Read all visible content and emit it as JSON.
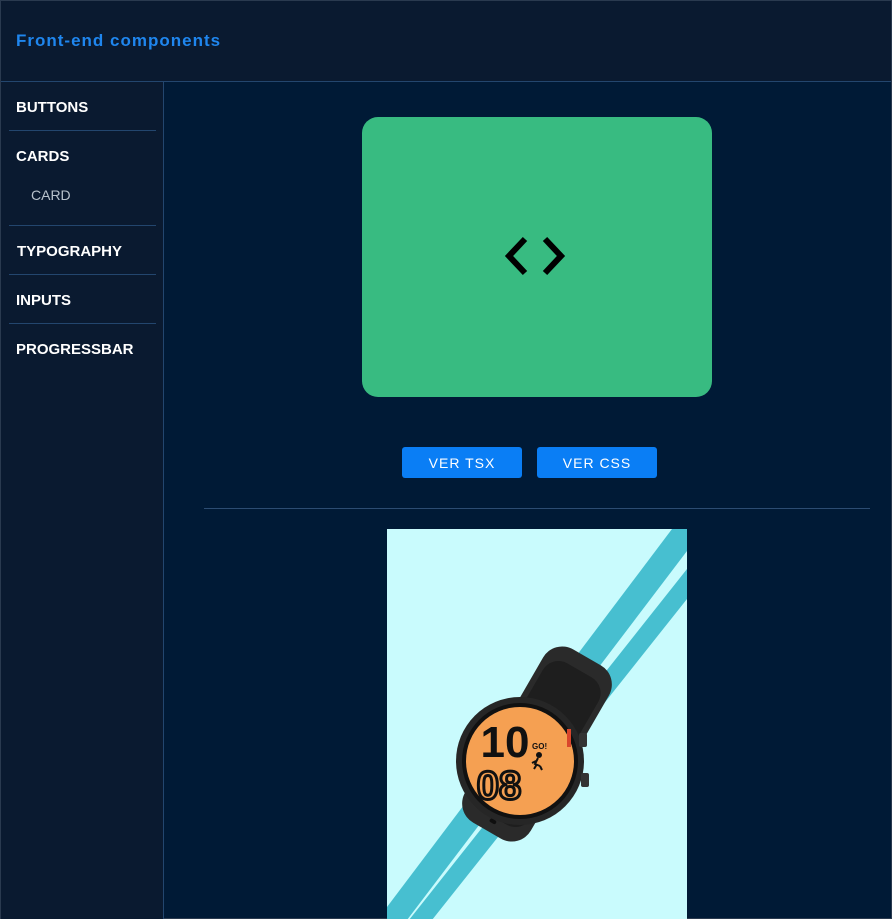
{
  "header": {
    "title": "Front-end components"
  },
  "sidebar": {
    "items": [
      {
        "label": "BUTTONS"
      },
      {
        "label": "CARDS",
        "children": [
          {
            "label": "CARD"
          }
        ]
      },
      {
        "label": "TYPOGRAPHY"
      },
      {
        "label": "INPUTS"
      },
      {
        "label": "PROGRESSBAR"
      }
    ]
  },
  "main": {
    "preview_card": {
      "icon": "code-icon",
      "color": "#38bb81"
    },
    "buttons": {
      "view_tsx": "VER TSX",
      "view_css": "VER CSS"
    },
    "product": {
      "image": "smartwatch-image",
      "watch_face": {
        "hour": "10",
        "minute": "08",
        "badge": "GO!"
      }
    }
  },
  "colors": {
    "accent": "#0a7ef5",
    "brand_title": "#1f86ee",
    "background": "#001a36",
    "sidebar": "#0a1a30",
    "card": "#38bb81",
    "product_bg": "#c9fbfd",
    "stripe": "#47bfd0",
    "watch_face": "#f5a052"
  }
}
